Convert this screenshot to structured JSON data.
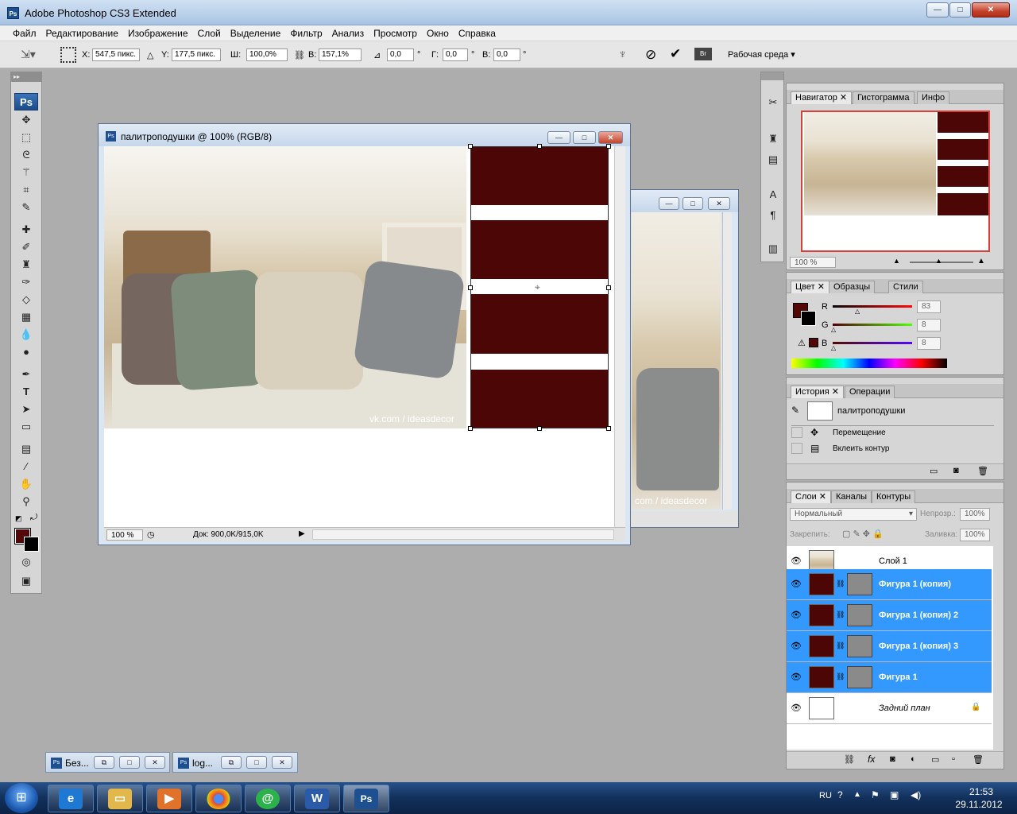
{
  "app": {
    "title": "Adobe Photoshop CS3 Extended"
  },
  "window_buttons": {
    "min": "—",
    "max": "□",
    "close": "✕"
  },
  "menu": [
    "Файл",
    "Редактирование",
    "Изображение",
    "Слой",
    "Выделение",
    "Фильтр",
    "Анализ",
    "Просмотр",
    "Окно",
    "Справка"
  ],
  "options": {
    "x_label": "X:",
    "x_value": "547,5 пикс.",
    "y_label": "Y:",
    "y_value": "177,5 пикс.",
    "w_label": "Ш:",
    "w_value": "100,0%",
    "h_label": "В:",
    "h_value": "157,1%",
    "angle_value": "0,0",
    "deg": "°",
    "hskew_label": "Г:",
    "hskew_value": "0,0",
    "vskew_label": "В:",
    "vskew_value": "0,0",
    "workspace": "Рабочая среда"
  },
  "toolbox": {
    "logo": "Ps"
  },
  "doc1": {
    "title": "палитроподушки @ 100% (RGB/8)",
    "watermark": "vk.com / ideasdecor",
    "zoom": "100 %",
    "doc_info": "Док: 900,0K/915,0K"
  },
  "doc2": {
    "watermark": "com / ideasdecor"
  },
  "navigator": {
    "tabs": [
      "Навигатор",
      "Гистограмма",
      "Инфо"
    ],
    "zoom": "100 %"
  },
  "color_panel": {
    "tabs": [
      "Цвет",
      "Образцы",
      "Стили"
    ],
    "r_label": "R",
    "r_value": "83",
    "g_label": "G",
    "g_value": "8",
    "b_label": "B",
    "b_value": "8",
    "fg_color": "#530808"
  },
  "history": {
    "tabs": [
      "История",
      "Операции"
    ],
    "snapshot": "палитроподушки",
    "items": [
      "Перемещение",
      "Вклеить контур"
    ]
  },
  "layers": {
    "tabs": [
      "Слои",
      "Каналы",
      "Контуры"
    ],
    "blend_mode": "Нормальный",
    "opacity_label": "Непрозр.:",
    "opacity": "100%",
    "lock_label": "Закрепить:",
    "fill_label": "Заливка:",
    "fill": "100%",
    "rows": [
      {
        "name": "Слой 1",
        "selected": false
      },
      {
        "name": "Фигура 1 (копия)",
        "selected": true
      },
      {
        "name": "Фигура 1 (копия) 2",
        "selected": true
      },
      {
        "name": "Фигура 1 (копия) 3",
        "selected": true
      },
      {
        "name": "Фигура 1",
        "selected": true
      },
      {
        "name": "Задний план",
        "selected": false
      }
    ]
  },
  "minimized": [
    {
      "label": "Без..."
    },
    {
      "label": "log..."
    }
  ],
  "taskbar": {
    "lang": "RU",
    "time": "21:53",
    "date": "29.11.2012",
    "ps_label": "Ps"
  }
}
